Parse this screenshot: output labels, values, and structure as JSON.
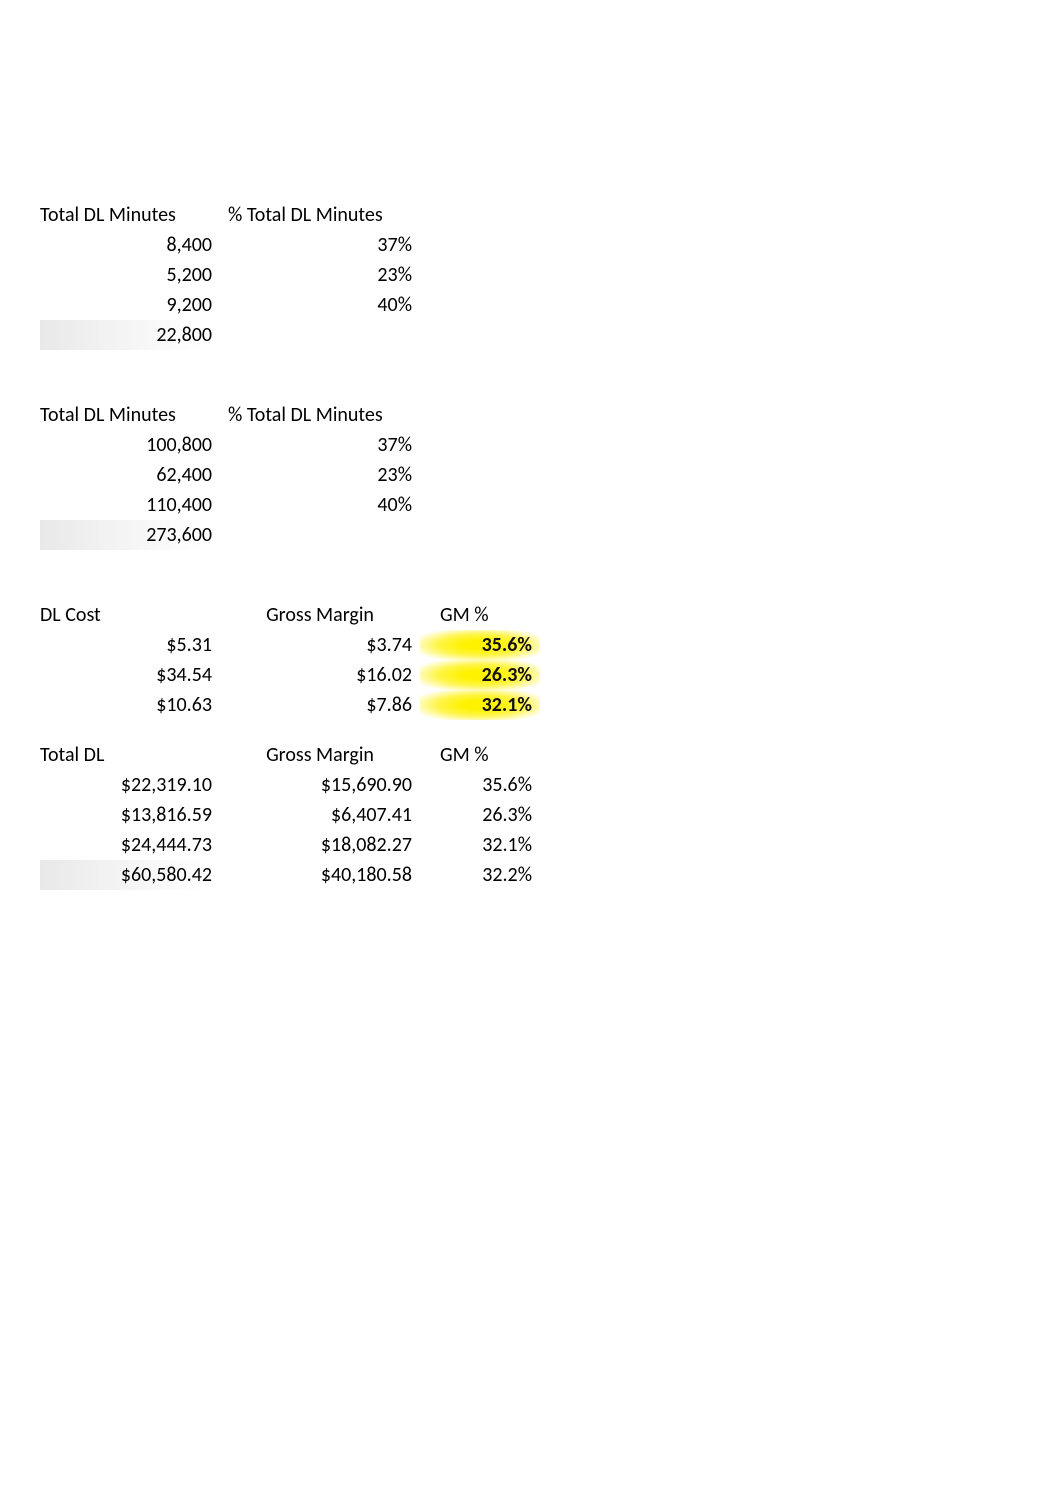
{
  "table1": {
    "headers": {
      "a": "Total DL Minutes",
      "b": "% Total DL Minutes"
    },
    "rows": [
      {
        "a": "8,400",
        "b": "37%"
      },
      {
        "a": "5,200",
        "b": "23%"
      },
      {
        "a": "9,200",
        "b": "40%"
      }
    ],
    "total": {
      "a": "22,800"
    }
  },
  "table2": {
    "headers": {
      "a": "Total DL Minutes",
      "b": "% Total DL Minutes"
    },
    "rows": [
      {
        "a": "100,800",
        "b": "37%"
      },
      {
        "a": "62,400",
        "b": "23%"
      },
      {
        "a": "110,400",
        "b": "40%"
      }
    ],
    "total": {
      "a": "273,600"
    }
  },
  "table3": {
    "headers": {
      "a": "DL Cost",
      "b": "Gross Margin",
      "c": "GM %"
    },
    "rows": [
      {
        "a": "$5.31",
        "b": "$3.74",
        "c": "35.6%"
      },
      {
        "a": "$34.54",
        "b": "$16.02",
        "c": "26.3%"
      },
      {
        "a": "$10.63",
        "b": "$7.86",
        "c": "32.1%"
      }
    ]
  },
  "table4": {
    "headers": {
      "a": "Total DL",
      "b": "Gross Margin",
      "c": "GM %"
    },
    "rows": [
      {
        "a": "$22,319.10",
        "b": "$15,690.90",
        "c": "35.6%"
      },
      {
        "a": "$13,816.59",
        "b": "$6,407.41",
        "c": "26.3%"
      },
      {
        "a": "$24,444.73",
        "b": "$18,082.27",
        "c": "32.1%"
      }
    ],
    "total": {
      "a": "$60,580.42",
      "b": "$40,180.58",
      "c": "32.2%"
    }
  }
}
